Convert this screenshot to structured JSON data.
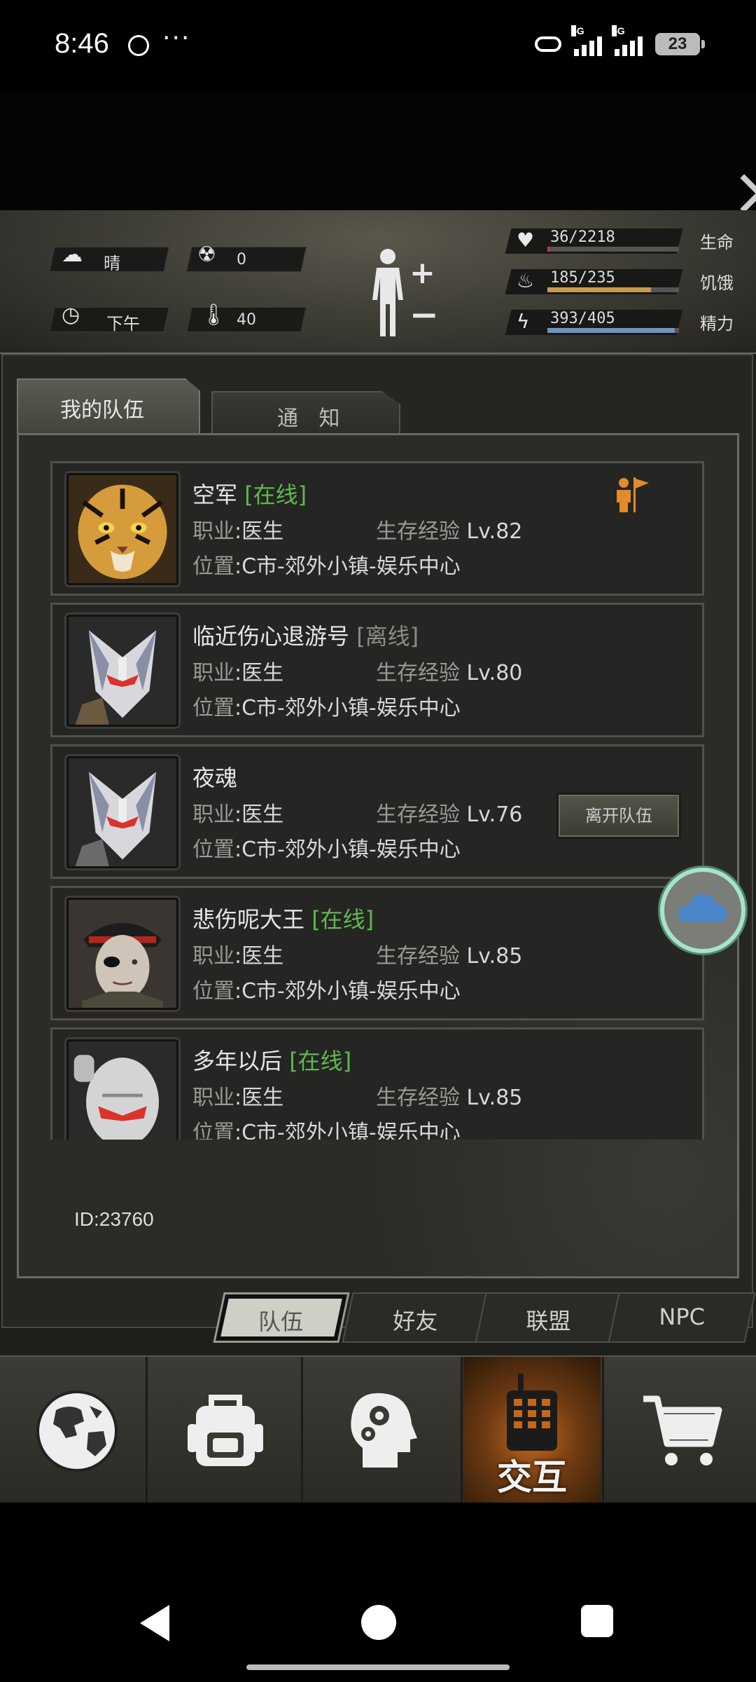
{
  "status_bar": {
    "time": "8:46",
    "dots": "···",
    "battery": "23",
    "net1": "5G",
    "net2": "5G"
  },
  "hud": {
    "weather": "晴",
    "radiation": "0",
    "time_of_day": "下午",
    "temperature": "40",
    "stats": [
      {
        "label": "生命",
        "value": "36/2218",
        "fill": 0.016,
        "color": "#c2424a"
      },
      {
        "label": "饥饿",
        "value": "185/235",
        "fill": 0.787,
        "color": "#c79a4f"
      },
      {
        "label": "精力",
        "value": "393/405",
        "fill": 0.97,
        "color": "#6d93c8"
      }
    ]
  },
  "tabs": {
    "my_team": "我的队伍",
    "notice": "通 知"
  },
  "labels": {
    "job": "职业",
    "exp": "生存经验",
    "loc": "位置"
  },
  "members": [
    {
      "name": "空军",
      "status": "[在线]",
      "online": true,
      "job": ":医生",
      "level": "Lv.82",
      "location": ":C市-郊外小镇-娱乐中心",
      "leader": true
    },
    {
      "name": "临近伤心退游号",
      "status": "[离线]",
      "online": false,
      "job": ":医生",
      "level": "Lv.80",
      "location": ":C市-郊外小镇-娱乐中心"
    },
    {
      "name": "夜魂",
      "status": "",
      "online": true,
      "job": ":医生",
      "level": "Lv.76",
      "location": ":C市-郊外小镇-娱乐中心",
      "leave_button": "离开队伍"
    },
    {
      "name": "悲伤呢大王",
      "status": "[在线]",
      "online": true,
      "job": ":医生",
      "level": "Lv.85",
      "location": ":C市-郊外小镇-娱乐中心"
    },
    {
      "name": "多年以后",
      "status": "[在线]",
      "online": true,
      "job": ":医生",
      "level": "Lv.85",
      "location": ":C市-郊外小镇-娱乐中心"
    }
  ],
  "player_id": "ID:23760",
  "subtabs": [
    "队伍",
    "好友",
    "联盟",
    "NPC"
  ],
  "nav": {
    "interact_label": "交互"
  },
  "icons": [
    "globe-icon",
    "backpack-icon",
    "skills-head-icon",
    "radio-icon",
    "cart-icon"
  ]
}
